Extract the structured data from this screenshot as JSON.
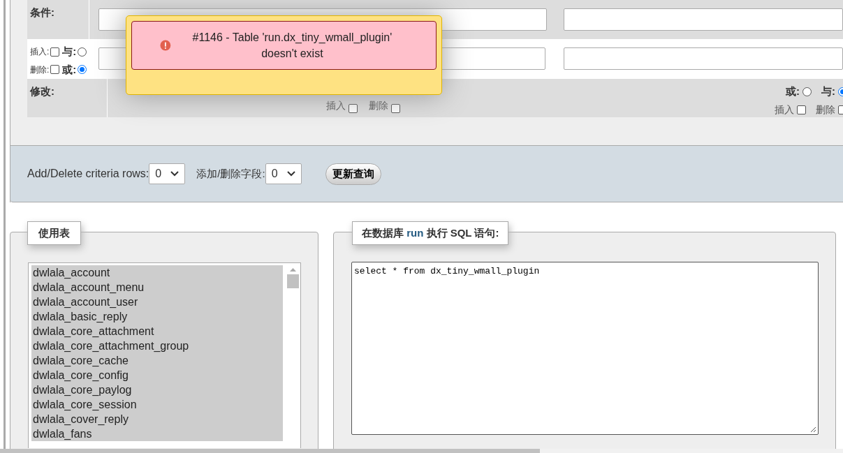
{
  "criteria": {
    "label": "条件:"
  },
  "row_controls": {
    "insert_label": "插入:",
    "insert_checked": false,
    "and_label": "与:",
    "and_selected": false,
    "delete_label": "删除:",
    "delete_checked": false,
    "or_label": "或:",
    "or_selected": true
  },
  "modify": {
    "label": "修改:"
  },
  "column_2_controls": {
    "insert_label": "插入",
    "insert_checked": false,
    "delete_label": "删除",
    "delete_checked": false
  },
  "column_3_controls": {
    "or_label": "或:",
    "or_selected": false,
    "and_label": "与:",
    "and_selected": true,
    "insert_label": "插入",
    "insert_checked": false,
    "delete_label": "删除",
    "delete_checked": false
  },
  "error": {
    "message": "#1146 - Table 'run.dx_tiny_wmall_plugin' doesn't exist"
  },
  "criteria_bar": {
    "rows_label": "Add/Delete criteria rows:",
    "rows_value": "0",
    "fields_label": "添加/删除字段:",
    "fields_value": "0",
    "button": "更新查询"
  },
  "tables_panel": {
    "legend": "使用表",
    "items": [
      {
        "label": "dwlala_account",
        "selected": true
      },
      {
        "label": "dwlala_account_menu",
        "selected": true
      },
      {
        "label": "dwlala_account_user",
        "selected": true
      },
      {
        "label": "dwlala_basic_reply",
        "selected": true
      },
      {
        "label": "dwlala_core_attachment",
        "selected": true
      },
      {
        "label": "dwlala_core_attachment_group",
        "selected": true
      },
      {
        "label": "dwlala_core_cache",
        "selected": true
      },
      {
        "label": "dwlala_core_config",
        "selected": true
      },
      {
        "label": "dwlala_core_paylog",
        "selected": true
      },
      {
        "label": "dwlala_core_session",
        "selected": true
      },
      {
        "label": "dwlala_cover_reply",
        "selected": true
      },
      {
        "label": "dwlala_fans",
        "selected": true
      }
    ]
  },
  "sql_panel": {
    "legend": "在数据库 **run** 执行 SQL 语句:",
    "query": "select * from dx_tiny_wmall_plugin"
  }
}
